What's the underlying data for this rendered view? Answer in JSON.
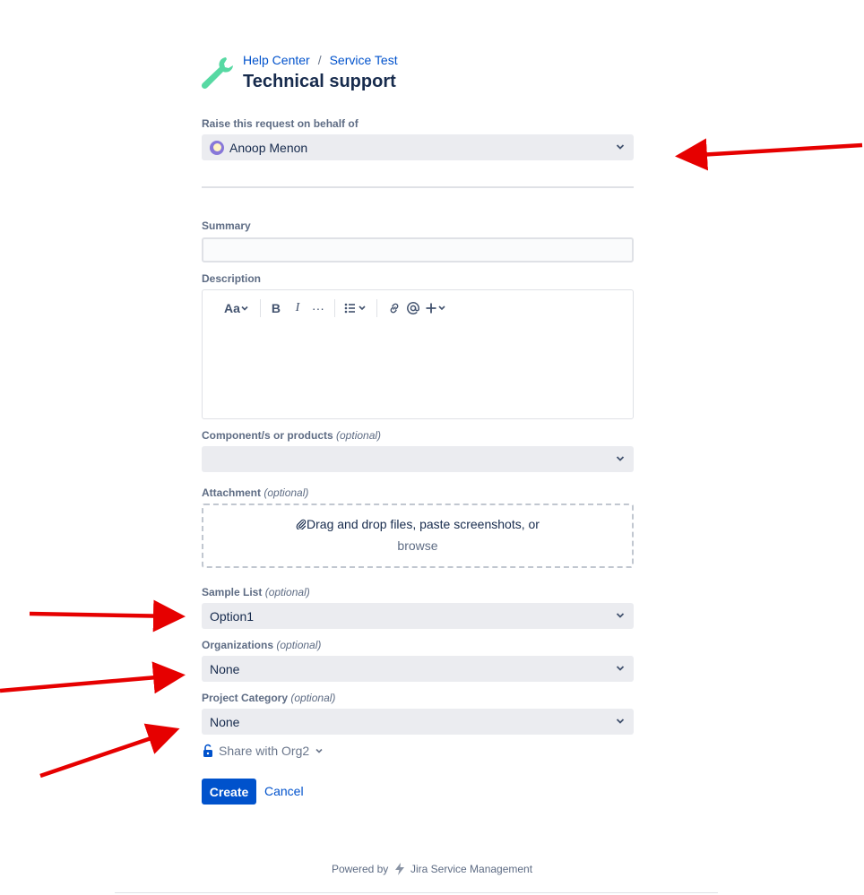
{
  "header": {
    "breadcrumbs": [
      "Help Center",
      "Service Test"
    ],
    "breadcrumb_separator": "/",
    "title": "Technical support"
  },
  "form": {
    "on_behalf": {
      "label": "Raise this request on behalf of",
      "value": "Anoop Menon"
    },
    "summary": {
      "label": "Summary",
      "value": ""
    },
    "description": {
      "label": "Description",
      "toolbar": {
        "text_style": "Aa",
        "bold": "B",
        "italic": "I",
        "more": "···"
      }
    },
    "components": {
      "label": "Component/s or products",
      "optional": "(optional)",
      "value": ""
    },
    "attachment": {
      "label": "Attachment",
      "optional": "(optional)",
      "drop_text": "Drag and drop files, paste screenshots, or",
      "browse_text": "browse"
    },
    "sample_list": {
      "label": "Sample List",
      "optional": "(optional)",
      "value": "Option1"
    },
    "organizations": {
      "label": "Organizations",
      "optional": "(optional)",
      "value": "None"
    },
    "project_category": {
      "label": "Project Category",
      "optional": "(optional)",
      "value": "None"
    },
    "share": {
      "label": "Share with Org2"
    },
    "actions": {
      "create": "Create",
      "cancel": "Cancel"
    }
  },
  "footer": {
    "powered_by": "Powered by",
    "product": "Jira Service Management"
  },
  "colors": {
    "accent": "#0052cc",
    "logo": "#57d9a3",
    "annotation_arrow": "#e60000",
    "select_bg": "#ebecf0"
  }
}
